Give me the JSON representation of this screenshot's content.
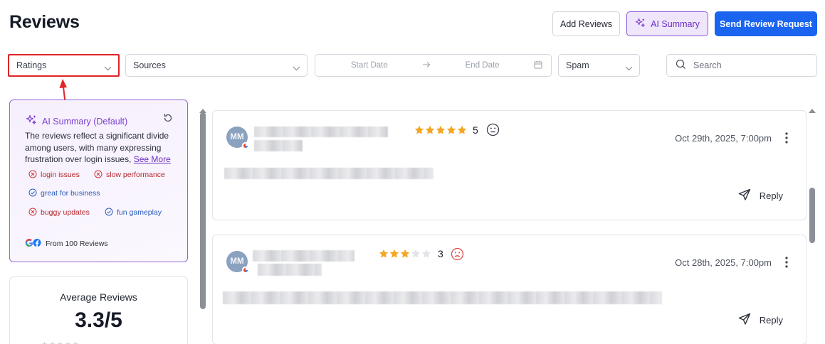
{
  "page": {
    "title": "Reviews"
  },
  "toolbar": {
    "add_reviews": "Add Reviews",
    "ai_summary": "AI Summary",
    "send_request": "Send Review Request"
  },
  "filters": {
    "ratings": "Ratings",
    "sources": "Sources",
    "start_date": "Start Date",
    "end_date": "End Date",
    "spam": "Spam",
    "search_placeholder": "Search"
  },
  "ai_summary_card": {
    "title": "AI Summary (Default)",
    "text": "The reviews reflect a significant divide among users, with many expressing frustration over login issues,",
    "see_more": "See More",
    "tags": [
      {
        "label": "login issues",
        "kind": "negative"
      },
      {
        "label": "slow performance",
        "kind": "negative"
      },
      {
        "label": "great for business",
        "kind": "positive"
      },
      {
        "label": "buggy updates",
        "kind": "negative"
      },
      {
        "label": "fun gameplay",
        "kind": "positive"
      }
    ],
    "footer": "From 100 Reviews"
  },
  "average": {
    "title": "Average Reviews",
    "value": "3.3/5"
  },
  "reviews": [
    {
      "initials": "MM",
      "rating": 5,
      "rating_label": "5",
      "sentiment": "neutral",
      "date": "Oct 29th, 2025, 7:00pm",
      "reply": "Reply"
    },
    {
      "initials": "MM",
      "rating": 3,
      "rating_label": "3",
      "sentiment": "negative",
      "date": "Oct 28th, 2025, 7:00pm",
      "reply": "Reply"
    }
  ],
  "colors": {
    "accent_purple": "#7b3fd0",
    "primary_blue": "#1a64f0",
    "star_gold": "#f5a623",
    "annotation_red": "#e02424"
  }
}
